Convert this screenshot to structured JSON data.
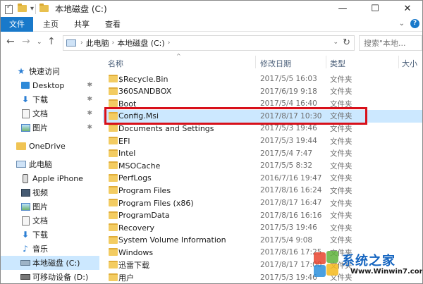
{
  "window": {
    "title": "本地磁盘 (C:)"
  },
  "ribbon": {
    "tabs": [
      "文件",
      "主页",
      "共享",
      "查看"
    ]
  },
  "address": {
    "crumbs": [
      "此电脑",
      "本地磁盘 (C:)"
    ],
    "search_placeholder": "搜索\"本地..."
  },
  "nav": {
    "items": [
      {
        "label": "快速访问",
        "icon": "star-icon",
        "pinned": false
      },
      {
        "label": "Desktop",
        "icon": "desktop-icon",
        "pinned": true
      },
      {
        "label": "下载",
        "icon": "download-icon",
        "pinned": true
      },
      {
        "label": "文档",
        "icon": "document-icon",
        "pinned": true
      },
      {
        "label": "图片",
        "icon": "picture-icon",
        "pinned": true
      },
      {
        "label": "OneDrive",
        "icon": "folder-icon",
        "pinned": false
      },
      {
        "label": "此电脑",
        "icon": "computer-icon",
        "pinned": false
      },
      {
        "label": "Apple iPhone",
        "icon": "phone-icon",
        "pinned": false
      },
      {
        "label": "视频",
        "icon": "video-icon",
        "pinned": false
      },
      {
        "label": "图片",
        "icon": "picture-icon",
        "pinned": false
      },
      {
        "label": "文档",
        "icon": "document-icon",
        "pinned": false
      },
      {
        "label": "下载",
        "icon": "download-icon",
        "pinned": false
      },
      {
        "label": "音乐",
        "icon": "music-icon",
        "pinned": false
      },
      {
        "label": "本地磁盘 (C:)",
        "icon": "drive-icon",
        "pinned": false,
        "selected": true
      },
      {
        "label": "可移动设备 (D:)",
        "icon": "usb-drive-icon",
        "pinned": false
      }
    ]
  },
  "columns": {
    "name": "名称",
    "modified": "修改日期",
    "type": "类型",
    "size": "大小"
  },
  "files": [
    {
      "name": "$Recycle.Bin",
      "date": "2017/5/5 16:03",
      "type": "文件夹"
    },
    {
      "name": "360SANDBOX",
      "date": "2017/6/19 9:18",
      "type": "文件夹"
    },
    {
      "name": "Boot",
      "date": "2017/5/4 16:40",
      "type": "文件夹"
    },
    {
      "name": "Config.Msi",
      "date": "2017/8/17 10:30",
      "type": "文件夹",
      "selected": true
    },
    {
      "name": "Documents and Settings",
      "date": "2017/5/3 19:46",
      "type": "文件夹"
    },
    {
      "name": "EFI",
      "date": "2017/5/3 19:44",
      "type": "文件夹"
    },
    {
      "name": "Intel",
      "date": "2017/5/4 7:47",
      "type": "文件夹"
    },
    {
      "name": "MSOCache",
      "date": "2017/5/5 8:32",
      "type": "文件夹"
    },
    {
      "name": "PerfLogs",
      "date": "2016/7/16 19:47",
      "type": "文件夹"
    },
    {
      "name": "Program Files",
      "date": "2017/8/16 16:24",
      "type": "文件夹"
    },
    {
      "name": "Program Files (x86)",
      "date": "2017/8/17 16:47",
      "type": "文件夹"
    },
    {
      "name": "ProgramData",
      "date": "2017/8/16 16:16",
      "type": "文件夹"
    },
    {
      "name": "Recovery",
      "date": "2017/5/3 19:46",
      "type": "文件夹"
    },
    {
      "name": "System Volume Information",
      "date": "2017/5/4 9:08",
      "type": "文件夹"
    },
    {
      "name": "Windows",
      "date": "2017/8/16 17:25",
      "type": "文件夹"
    },
    {
      "name": "迅雷下载",
      "date": "2017/8/17 17:00",
      "type": "文件夹"
    },
    {
      "name": "用户",
      "date": "2017/5/3 19:46",
      "type": "文件夹"
    }
  ],
  "watermark": {
    "brand": "系统之家",
    "url": "Www.Winwin7.com"
  },
  "colors": {
    "accent": "#1979ca",
    "selection": "#cce8ff",
    "highlight_border": "#d8101a",
    "folder": "#f3cc62"
  }
}
